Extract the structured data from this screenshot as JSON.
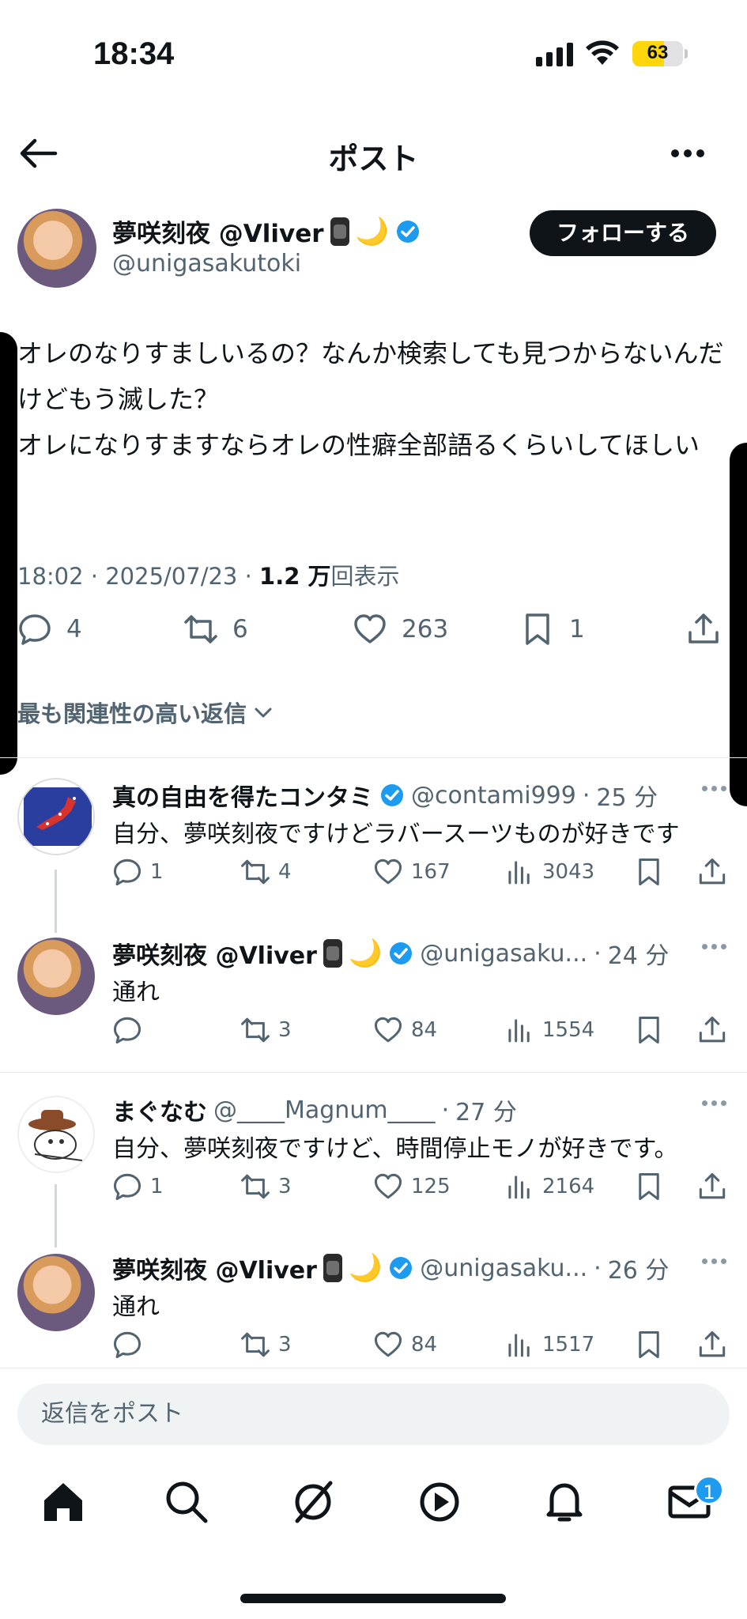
{
  "status_bar": {
    "time": "18:34",
    "battery": "63",
    "battery_level": 0.63
  },
  "header": {
    "title": "ポスト"
  },
  "post": {
    "author_name": "夢咲刻夜 @Vliver",
    "author_emoji": "🌙",
    "author_handle": "@unigasakutoki",
    "follow_label": "フォローする",
    "body": "オレのなりすましいるの？なんか検索しても見つからないんだけどもう滅した？\nオレになりすますならオレの性癖全部語るくらいしてほしい",
    "time": "18:02",
    "date": "2025/07/23",
    "views_count": "1.2 万",
    "views_label": "回表示",
    "replies": "4",
    "reposts": "6",
    "likes": "263",
    "bookmarks": "1"
  },
  "sort_label": "最も関連性の高い返信",
  "replies": [
    {
      "name": "真の自由を得たコンタミ",
      "handle": "@contami999",
      "time": "25 分",
      "text": "自分、夢咲刻夜ですけどラバースーツものが好きです",
      "replies": "1",
      "reposts": "4",
      "likes": "167",
      "views": "3043"
    },
    {
      "name": "夢咲刻夜 @Vliver",
      "handle": "@unigasaku...",
      "time": "24 分",
      "text": "通れ",
      "replies": "",
      "reposts": "3",
      "likes": "84",
      "views": "1554"
    },
    {
      "name": "まぐなむ",
      "handle": "@____Magnum____",
      "time": "27 分",
      "text": "自分、夢咲刻夜ですけど、時間停止モノが好きです。",
      "replies": "1",
      "reposts": "3",
      "likes": "125",
      "views": "2164"
    },
    {
      "name": "夢咲刻夜 @Vliver",
      "handle": "@unigasaku...",
      "time": "26 分",
      "text": "通れ",
      "replies": "",
      "reposts": "3",
      "likes": "84",
      "views": "1517"
    }
  ],
  "composer": {
    "placeholder": "返信をポスト"
  },
  "tabbar": {
    "messages_badge": "1"
  },
  "icons": [
    "back-arrow-icon",
    "more-icon",
    "verified-icon",
    "reply-icon",
    "repost-icon",
    "like-icon",
    "bookmark-icon",
    "share-icon",
    "views-icon",
    "home-icon",
    "search-icon",
    "grok-icon",
    "play-icon",
    "bell-icon",
    "mail-icon"
  ],
  "colors": {
    "verified": "#1d9bf0",
    "text": "#0f1419",
    "muted": "#536471",
    "battery": "#ffd60a"
  }
}
